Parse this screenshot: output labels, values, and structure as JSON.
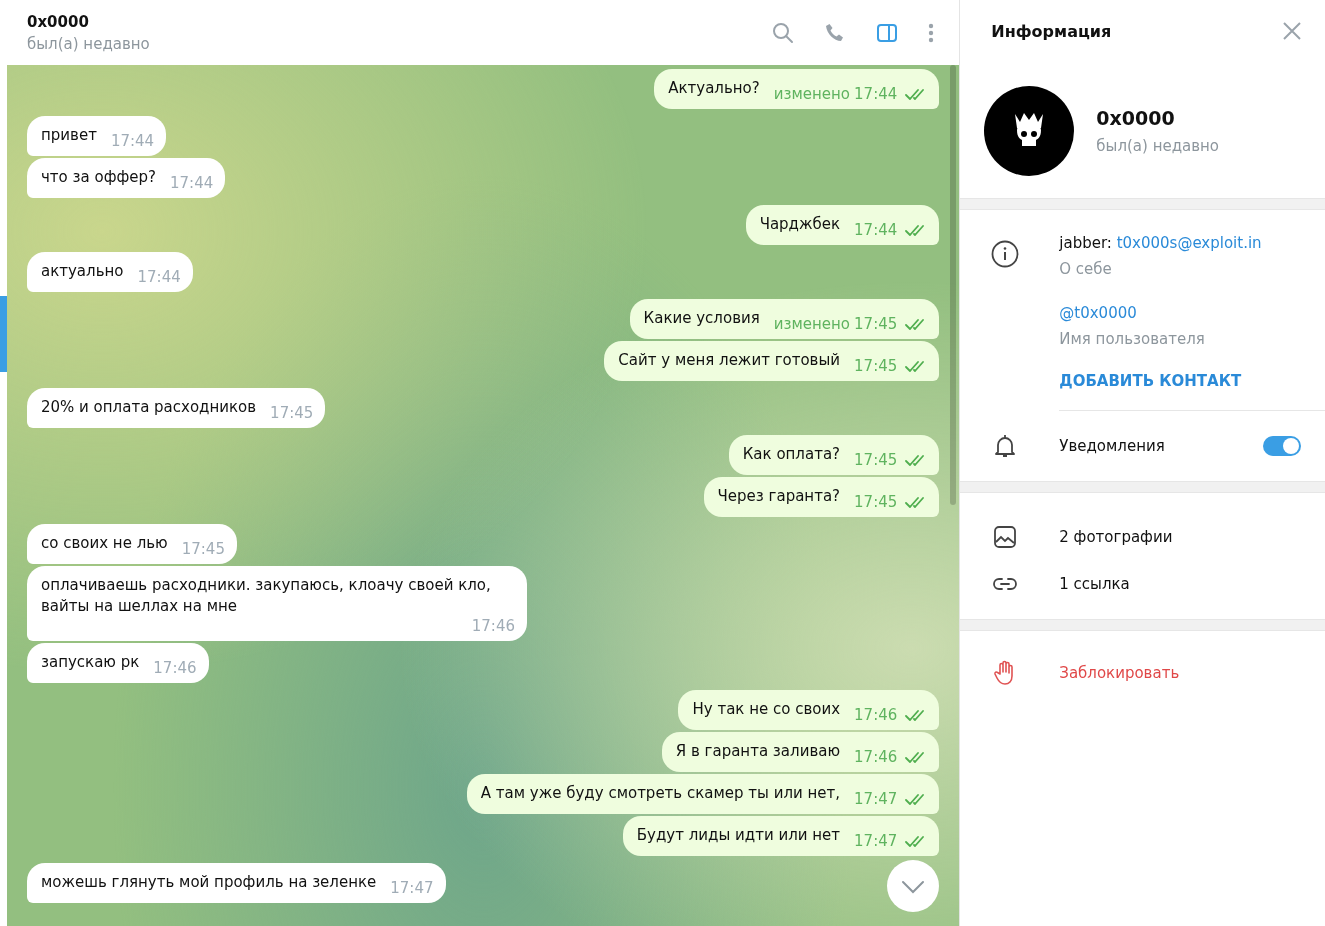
{
  "header": {
    "title": "0x0000",
    "status": "был(а) недавно",
    "panel_toggle_on": true
  },
  "message_groups": [
    {
      "outgoing": true,
      "messages": [
        {
          "text": "Актуально?",
          "time": "17:44",
          "edited": "изменено",
          "read": true
        }
      ]
    },
    {
      "outgoing": false,
      "messages": [
        {
          "text": "привет",
          "time": "17:44"
        },
        {
          "text": "что за оффер?",
          "time": "17:44"
        }
      ]
    },
    {
      "outgoing": true,
      "messages": [
        {
          "text": "Чарджбек",
          "time": "17:44",
          "read": true
        }
      ]
    },
    {
      "outgoing": false,
      "messages": [
        {
          "text": "актуально",
          "time": "17:44"
        }
      ]
    },
    {
      "outgoing": true,
      "messages": [
        {
          "text": "Какие условия",
          "time": "17:45",
          "edited": "изменено",
          "read": true
        },
        {
          "text": "Сайт у меня лежит готовый",
          "time": "17:45",
          "read": true
        }
      ]
    },
    {
      "outgoing": false,
      "messages": [
        {
          "text": "20% и оплата расходников",
          "time": "17:45"
        }
      ]
    },
    {
      "outgoing": true,
      "messages": [
        {
          "text": "Как оплата?",
          "time": "17:45",
          "read": true
        },
        {
          "text": "Через гаранта?",
          "time": "17:45",
          "read": true
        }
      ]
    },
    {
      "outgoing": false,
      "messages": [
        {
          "text": "со своих не лью",
          "time": "17:45"
        },
        {
          "text": "оплачиваешь расходники. закупаюсь, клоачу своей кло, вайты на шеллах на мне",
          "time": "17:46"
        },
        {
          "text": "запускаю рк",
          "time": "17:46"
        }
      ]
    },
    {
      "outgoing": true,
      "messages": [
        {
          "text": "Ну так не со своих",
          "time": "17:46",
          "read": true
        },
        {
          "text": "Я в гаранта заливаю",
          "time": "17:46",
          "read": true
        },
        {
          "text": "А там уже буду смотреть скамер ты или нет,",
          "time": "17:47",
          "read": true
        },
        {
          "text": "Будут лиды идти или нет",
          "time": "17:47",
          "read": true
        }
      ]
    },
    {
      "outgoing": false,
      "messages": [
        {
          "text": "можешь глянуть мой профиль на зеленке",
          "time": "17:47"
        }
      ]
    }
  ],
  "info_panel": {
    "title": "Информация",
    "name": "0x0000",
    "status": "был(а) недавно",
    "bio_prefix": "jabber:",
    "bio_link": "t0x000s@exploit.in",
    "bio_label": "О себе",
    "username": "@t0x0000",
    "username_label": "Имя пользователя",
    "add_contact": "ДОБАВИТЬ КОНТАКТ",
    "notifications": {
      "label": "Уведомления",
      "on": true
    },
    "media": [
      {
        "kind": "photos",
        "label": "2 фотографии"
      },
      {
        "kind": "links",
        "label": "1 ссылка"
      }
    ],
    "block": "Заблокировать"
  }
}
